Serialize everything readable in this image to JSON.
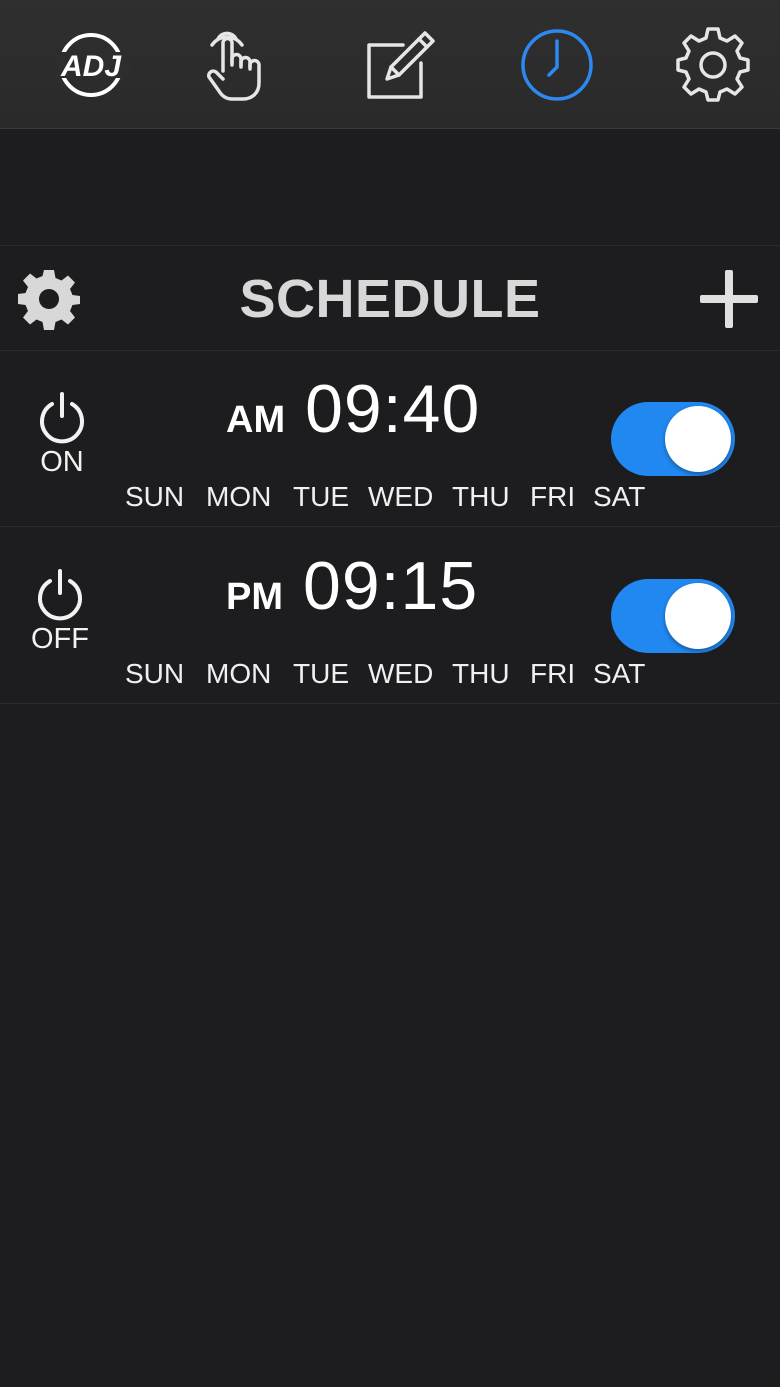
{
  "theme": {
    "background": "#1d1d1f",
    "topbar": "#2d2d2e",
    "accent": "#2d89ef",
    "icon": "#e6e6e6",
    "toggle_on": "#2088f0"
  },
  "nav": {
    "logo_text": "ADJ",
    "tabs": [
      {
        "name": "manual-control",
        "icon": "hand-pointer-icon",
        "active": false
      },
      {
        "name": "edit",
        "icon": "pencil-edit-icon",
        "active": false
      },
      {
        "name": "schedule",
        "icon": "clock-icon",
        "active": true
      },
      {
        "name": "settings",
        "icon": "gear-icon",
        "active": false
      }
    ]
  },
  "schedule": {
    "title": "SCHEDULE",
    "settings_icon": "gear-icon",
    "add_icon": "plus-icon"
  },
  "entries": [
    {
      "power_label": "ON",
      "meridiem": "AM",
      "time": "09:40",
      "days": [
        "SUN",
        "MON",
        "TUE",
        "WED",
        "THU",
        "FRI",
        "SAT"
      ],
      "enabled": true
    },
    {
      "power_label": "OFF",
      "meridiem": "PM",
      "time": "09:15",
      "days": [
        "SUN",
        "MON",
        "TUE",
        "WED",
        "THU",
        "FRI",
        "SAT"
      ],
      "enabled": true
    }
  ]
}
